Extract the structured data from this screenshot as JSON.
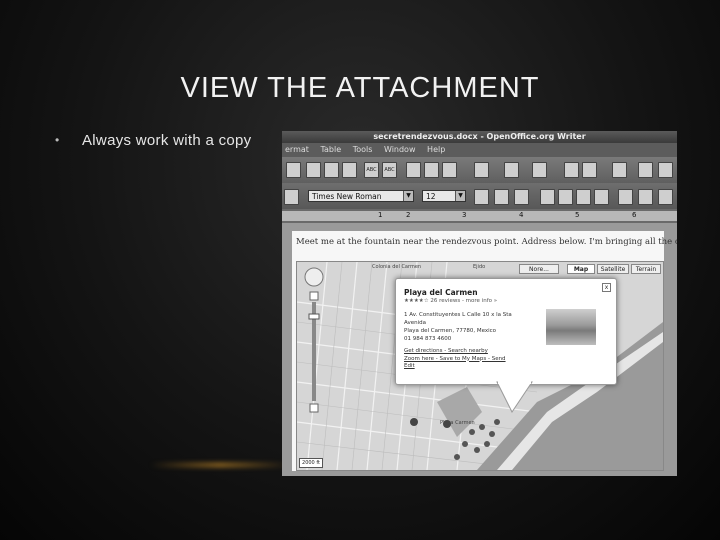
{
  "slide": {
    "title": "VIEW THE ATTACHMENT",
    "bullet_symbol": "•",
    "bullet_text": "Always work with a copy"
  },
  "window": {
    "title": "secretrendezvous.docx - OpenOffice.org Writer",
    "menu": [
      "ermat",
      "Table",
      "Tools",
      "Window",
      "Help"
    ]
  },
  "formatting": {
    "font_name": "Times New Roman",
    "font_size": "12",
    "ruler_numbers": [
      "1",
      "2",
      "3",
      "4",
      "5",
      "6"
    ]
  },
  "document": {
    "text": "Meet me at the fountain near the rendezvous point. Address below. I'm bringing all the cash."
  },
  "map": {
    "tabs": [
      "Map",
      "Satellite",
      "Terrain"
    ],
    "tab_partial": "Nore...",
    "labels": [
      "Colonia del Carmen",
      "Ejido",
      "Playa del Carmen",
      "Playa Carmen"
    ],
    "scale": "2000 ft",
    "popup": {
      "title": "Playa del Carmen",
      "close": "x",
      "rating": "★★★★☆ 26 reviews - more info »",
      "address": [
        "1 Av. Constituyentes L Calle 10 x la Sta",
        "Avenida",
        "Playa del Carmen, 77780, Mexico",
        "01 984 873 4600"
      ],
      "links": [
        "Get directions - Search nearby",
        "Zoom here - Save to My Maps - Send",
        "Edit"
      ]
    }
  },
  "colors": {
    "slide_bg": "#141414",
    "title_text": "#f2f2f2",
    "accent_glow": "#c88c28"
  }
}
